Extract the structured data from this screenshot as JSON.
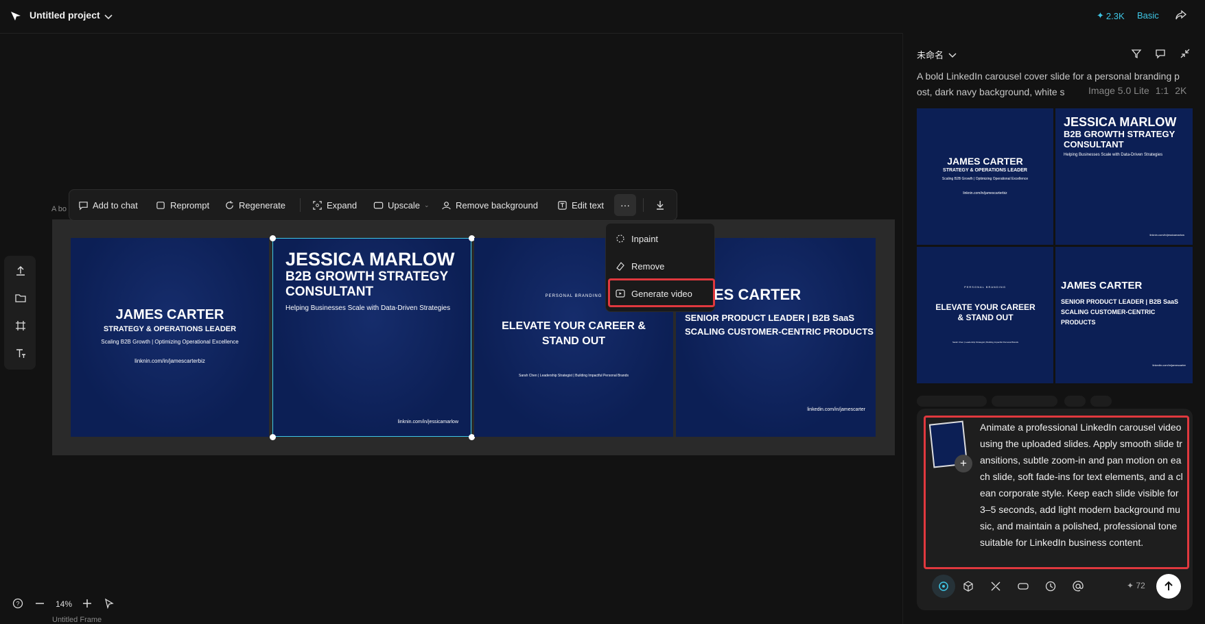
{
  "header": {
    "project_title": "Untitled project",
    "credits": "2.3K",
    "plan": "Basic"
  },
  "canvas": {
    "frame_label": "A bo",
    "frame_name": "Untitled Frame",
    "zoom": "14%",
    "slides": [
      {
        "name": "JAMES CARTER",
        "title": "STRATEGY & OPERATIONS LEADER",
        "subtitle": "Scaling B2B Growth | Optimizing Operational Excellence",
        "link": "linknin.com/in/jamescarterbiz"
      },
      {
        "name": "JESSICA MARLOW",
        "title": "B2B GROWTH STRATEGY CONSULTANT",
        "subtitle": "Helping Businesses Scale with Data-Driven Strategies",
        "link": "linknin.com/in/jessicamarlow"
      },
      {
        "eyebrow": "PERSONAL BRANDING",
        "headline": "ELEVATE YOUR CAREER & STAND OUT",
        "credit": "Sarah Chen | Leadership Strategist | Building Impactful Personal Brands"
      },
      {
        "name": "JAMES CARTER",
        "name_visible": "ES CARTER",
        "title": "SENIOR PRODUCT LEADER | B2B SaaS",
        "title2": "SCALING CUSTOMER-CENTRIC PRODUCTS",
        "link": "linkedin.com/in/jamescarter"
      }
    ]
  },
  "toolbar": {
    "add_to_chat": "Add to chat",
    "reprompt": "Reprompt",
    "regenerate": "Regenerate",
    "expand": "Expand",
    "upscale": "Upscale",
    "remove_background": "Remove background",
    "edit_text": "Edit text",
    "more": "···"
  },
  "more_menu": {
    "inpaint": "Inpaint",
    "remove": "Remove",
    "generate_video": "Generate video"
  },
  "right_panel": {
    "title": "未命名",
    "prompt": "A bold LinkedIn carousel cover slide for a personal branding p ost, dark navy background, white s",
    "model": "Image 5.0 Lite",
    "ratio": "1:1",
    "resolution": "2K",
    "thumbs": [
      {
        "name": "JAMES CARTER",
        "title": "STRATEGY & OPERATIONS LEADER",
        "subtitle": "Scaling B2B Growth | Optimizing Operational Excellence",
        "link": "linknin.com/in/jamescarterbiz"
      },
      {
        "name": "JESSICA MARLOW",
        "title": "B2B GROWTH STRATEGY CONSULTANT",
        "subtitle": "Helping Businesses Scale with Data-Driven Strategies",
        "link": "linknin.com/in/jessicamarlow"
      },
      {
        "eyebrow": "PERSONAL BRANDING",
        "headline": "ELEVATE YOUR CAREER & STAND OUT",
        "credit": "Sarah Chen | Leadership Strategist | Building Impactful Personal Brands"
      },
      {
        "name": "JAMES CARTER",
        "title": "SENIOR PRODUCT LEADER | B2B SaaS",
        "title2": "SCALING CUSTOMER-CENTRIC PRODUCTS",
        "link": "linkedin.com/in/jamescarter"
      }
    ]
  },
  "chat": {
    "input_text": "Animate a professional LinkedIn carousel video using the uploaded slides. Apply smooth slide transitions, subtle zoom-in and pan motion on each slide, soft fade-ins for text elements, and a clean corporate style. Keep each slide visible for 3–5 seconds, add light modern background music, and maintain a polished, professional tone suitable for LinkedIn business content.",
    "credits": "72"
  },
  "colors": {
    "accent": "#3fc7e6",
    "highlight": "#e0383e",
    "slide_bg": "#0c1f55"
  }
}
